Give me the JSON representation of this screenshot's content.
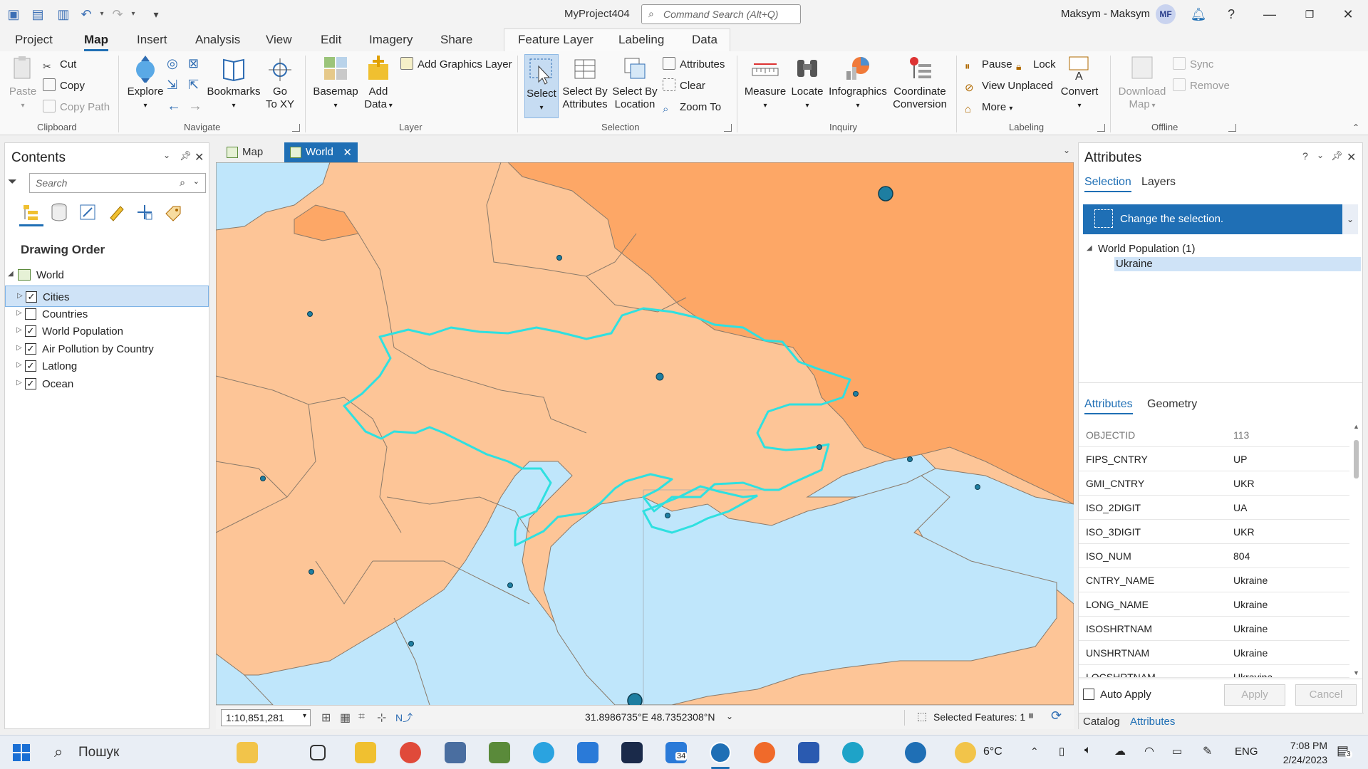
{
  "titlebar": {
    "project_name": "MyProject404",
    "search_placeholder": "Command Search (Alt+Q)",
    "user": "Maksym - Maksym",
    "user_initials": "MF"
  },
  "ribbon_tabs": [
    "Project",
    "Map",
    "Insert",
    "Analysis",
    "View",
    "Edit",
    "Imagery",
    "Share",
    "Feature Layer",
    "Labeling",
    "Data"
  ],
  "active_ribbon_tab": "Map",
  "ribbon": {
    "clipboard": {
      "paste": "Paste",
      "cut": "Cut",
      "copy": "Copy",
      "copy_path": "Copy Path",
      "label": "Clipboard"
    },
    "navigate": {
      "explore": "Explore",
      "bookmarks": "Bookmarks",
      "go_to_xy_1": "Go",
      "go_to_xy_2": "To XY",
      "label": "Navigate"
    },
    "layer": {
      "basemap": "Basemap",
      "add_data_1": "Add",
      "add_data_2": "Data",
      "add_graphics": "Add Graphics Layer",
      "label": "Layer"
    },
    "selection": {
      "select": "Select",
      "select_by_attr_1": "Select By",
      "select_by_attr_2": "Attributes",
      "select_by_loc_1": "Select By",
      "select_by_loc_2": "Location",
      "attributes": "Attributes",
      "clear": "Clear",
      "zoom_to": "Zoom To",
      "label": "Selection"
    },
    "inquiry": {
      "measure": "Measure",
      "locate": "Locate",
      "infographics": "Infographics",
      "coord_1": "Coordinate",
      "coord_2": "Conversion",
      "label": "Inquiry"
    },
    "labeling": {
      "pause": "Pause",
      "lock": "Lock",
      "view_unplaced": "View Unplaced",
      "more": "More",
      "convert": "Convert",
      "label": "Labeling"
    },
    "offline": {
      "download_1": "Download",
      "download_2": "Map",
      "sync": "Sync",
      "remove": "Remove",
      "label": "Offline"
    }
  },
  "contents": {
    "title": "Contents",
    "search_placeholder": "Search",
    "drawing_order": "Drawing Order",
    "map_name": "World",
    "layers": [
      {
        "name": "Cities",
        "checked": true,
        "selected": true
      },
      {
        "name": "Countries",
        "checked": false,
        "selected": false
      },
      {
        "name": "World Population",
        "checked": true,
        "selected": false
      },
      {
        "name": "Air Pollution by Country",
        "checked": true,
        "selected": false
      },
      {
        "name": "Latlong",
        "checked": true,
        "selected": false
      },
      {
        "name": "Ocean",
        "checked": true,
        "selected": false
      }
    ]
  },
  "map_tabs": [
    {
      "label": "Map",
      "active": false
    },
    {
      "label": "World",
      "active": true
    }
  ],
  "map_status": {
    "scale": "1:10,851,281",
    "coordinates": "31.8986735°E 48.7352308°N",
    "selected_features": "Selected Features: 1"
  },
  "attributes_pane": {
    "title": "Attributes",
    "tabs": [
      "Selection",
      "Layers"
    ],
    "change_selection": "Change the selection.",
    "selection_layer": "World Population  (1)",
    "selection_item": "Ukraine",
    "detail_tabs": [
      "Attributes",
      "Geometry"
    ],
    "fields": [
      {
        "name": "OBJECTID",
        "value": "113",
        "readonly": true
      },
      {
        "name": "FIPS_CNTRY",
        "value": "UP"
      },
      {
        "name": "GMI_CNTRY",
        "value": "UKR"
      },
      {
        "name": "ISO_2DIGIT",
        "value": "UA"
      },
      {
        "name": "ISO_3DIGIT",
        "value": "UKR"
      },
      {
        "name": "ISO_NUM",
        "value": "804"
      },
      {
        "name": "CNTRY_NAME",
        "value": "Ukraine"
      },
      {
        "name": "LONG_NAME",
        "value": "Ukraine"
      },
      {
        "name": "ISOSHRTNAM",
        "value": "Ukraine"
      },
      {
        "name": "UNSHRTNAM",
        "value": "Ukraine"
      },
      {
        "name": "LOCSHRTNAM",
        "value": "Ukrayina"
      }
    ],
    "auto_apply": "Auto Apply",
    "apply": "Apply",
    "cancel": "Cancel",
    "bottom_tabs": [
      "Catalog",
      "Attributes"
    ]
  },
  "taskbar": {
    "search": "Пошук",
    "temperature": "6°C",
    "language": "ENG",
    "time": "7:08 PM",
    "date": "2/24/2023",
    "badge_count": "34",
    "notif_count": "3"
  },
  "colors": {
    "accent": "#1f6fb5",
    "land": "#fdc597",
    "land_dark": "#fda766",
    "water": "#bfe6fb",
    "selection_outline": "#2fe0e0",
    "city": "#1e7ea1"
  }
}
